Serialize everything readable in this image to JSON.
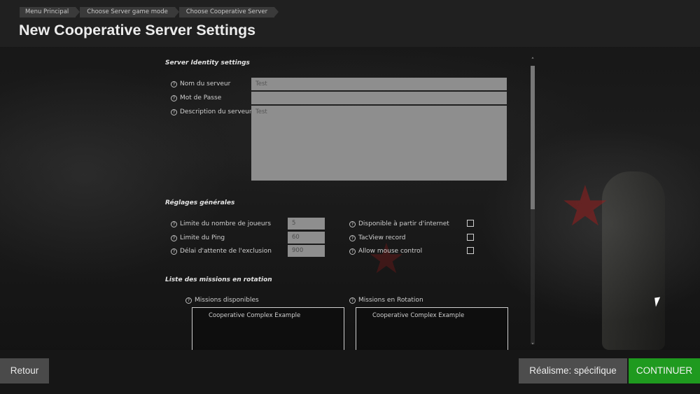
{
  "breadcrumb": [
    "Menu Principal",
    "Choose Server game mode",
    "Choose Cooperative Server"
  ],
  "page_title": "New Cooperative Server Settings",
  "identity": {
    "section_title": "Server Identity settings",
    "help_glyph": "?",
    "name_label": "Nom du serveur",
    "name_value": "Test",
    "password_label": "Mot de Passe",
    "password_value": "",
    "description_label": "Description du serveur",
    "description_value": "Test"
  },
  "general": {
    "section_title": "Réglages générales",
    "max_players_label": "Limite du nombre de joueurs",
    "max_players_value": "5",
    "ping_label": "Limite du Ping",
    "ping_value": "60",
    "kick_delay_label": "Délai d'attente de l'exclusion",
    "kick_delay_value": "900",
    "internet_label": "Disponible à partir d'internet",
    "internet_checked": false,
    "tacview_label": "TacView record",
    "tacview_checked": false,
    "mouse_label": "Allow mouse control",
    "mouse_checked": false
  },
  "missions": {
    "section_title": "Liste des missions en rotation",
    "available_label": "Missions disponibles",
    "available_items": [
      "Cooperative Complex Example"
    ],
    "rotation_label": "Missions en Rotation",
    "rotation_items": [
      "Cooperative Complex Example"
    ]
  },
  "footer": {
    "back_label": "Retour",
    "realism_label": "Réalisme: spécifique",
    "continue_label": "CONTINUER"
  },
  "colors": {
    "continue_green": "#1f9a1f",
    "field_gray": "#8e8e8e"
  },
  "icons": {
    "scroll_up": "˄",
    "scroll_down": "˅",
    "background_star": "★"
  }
}
